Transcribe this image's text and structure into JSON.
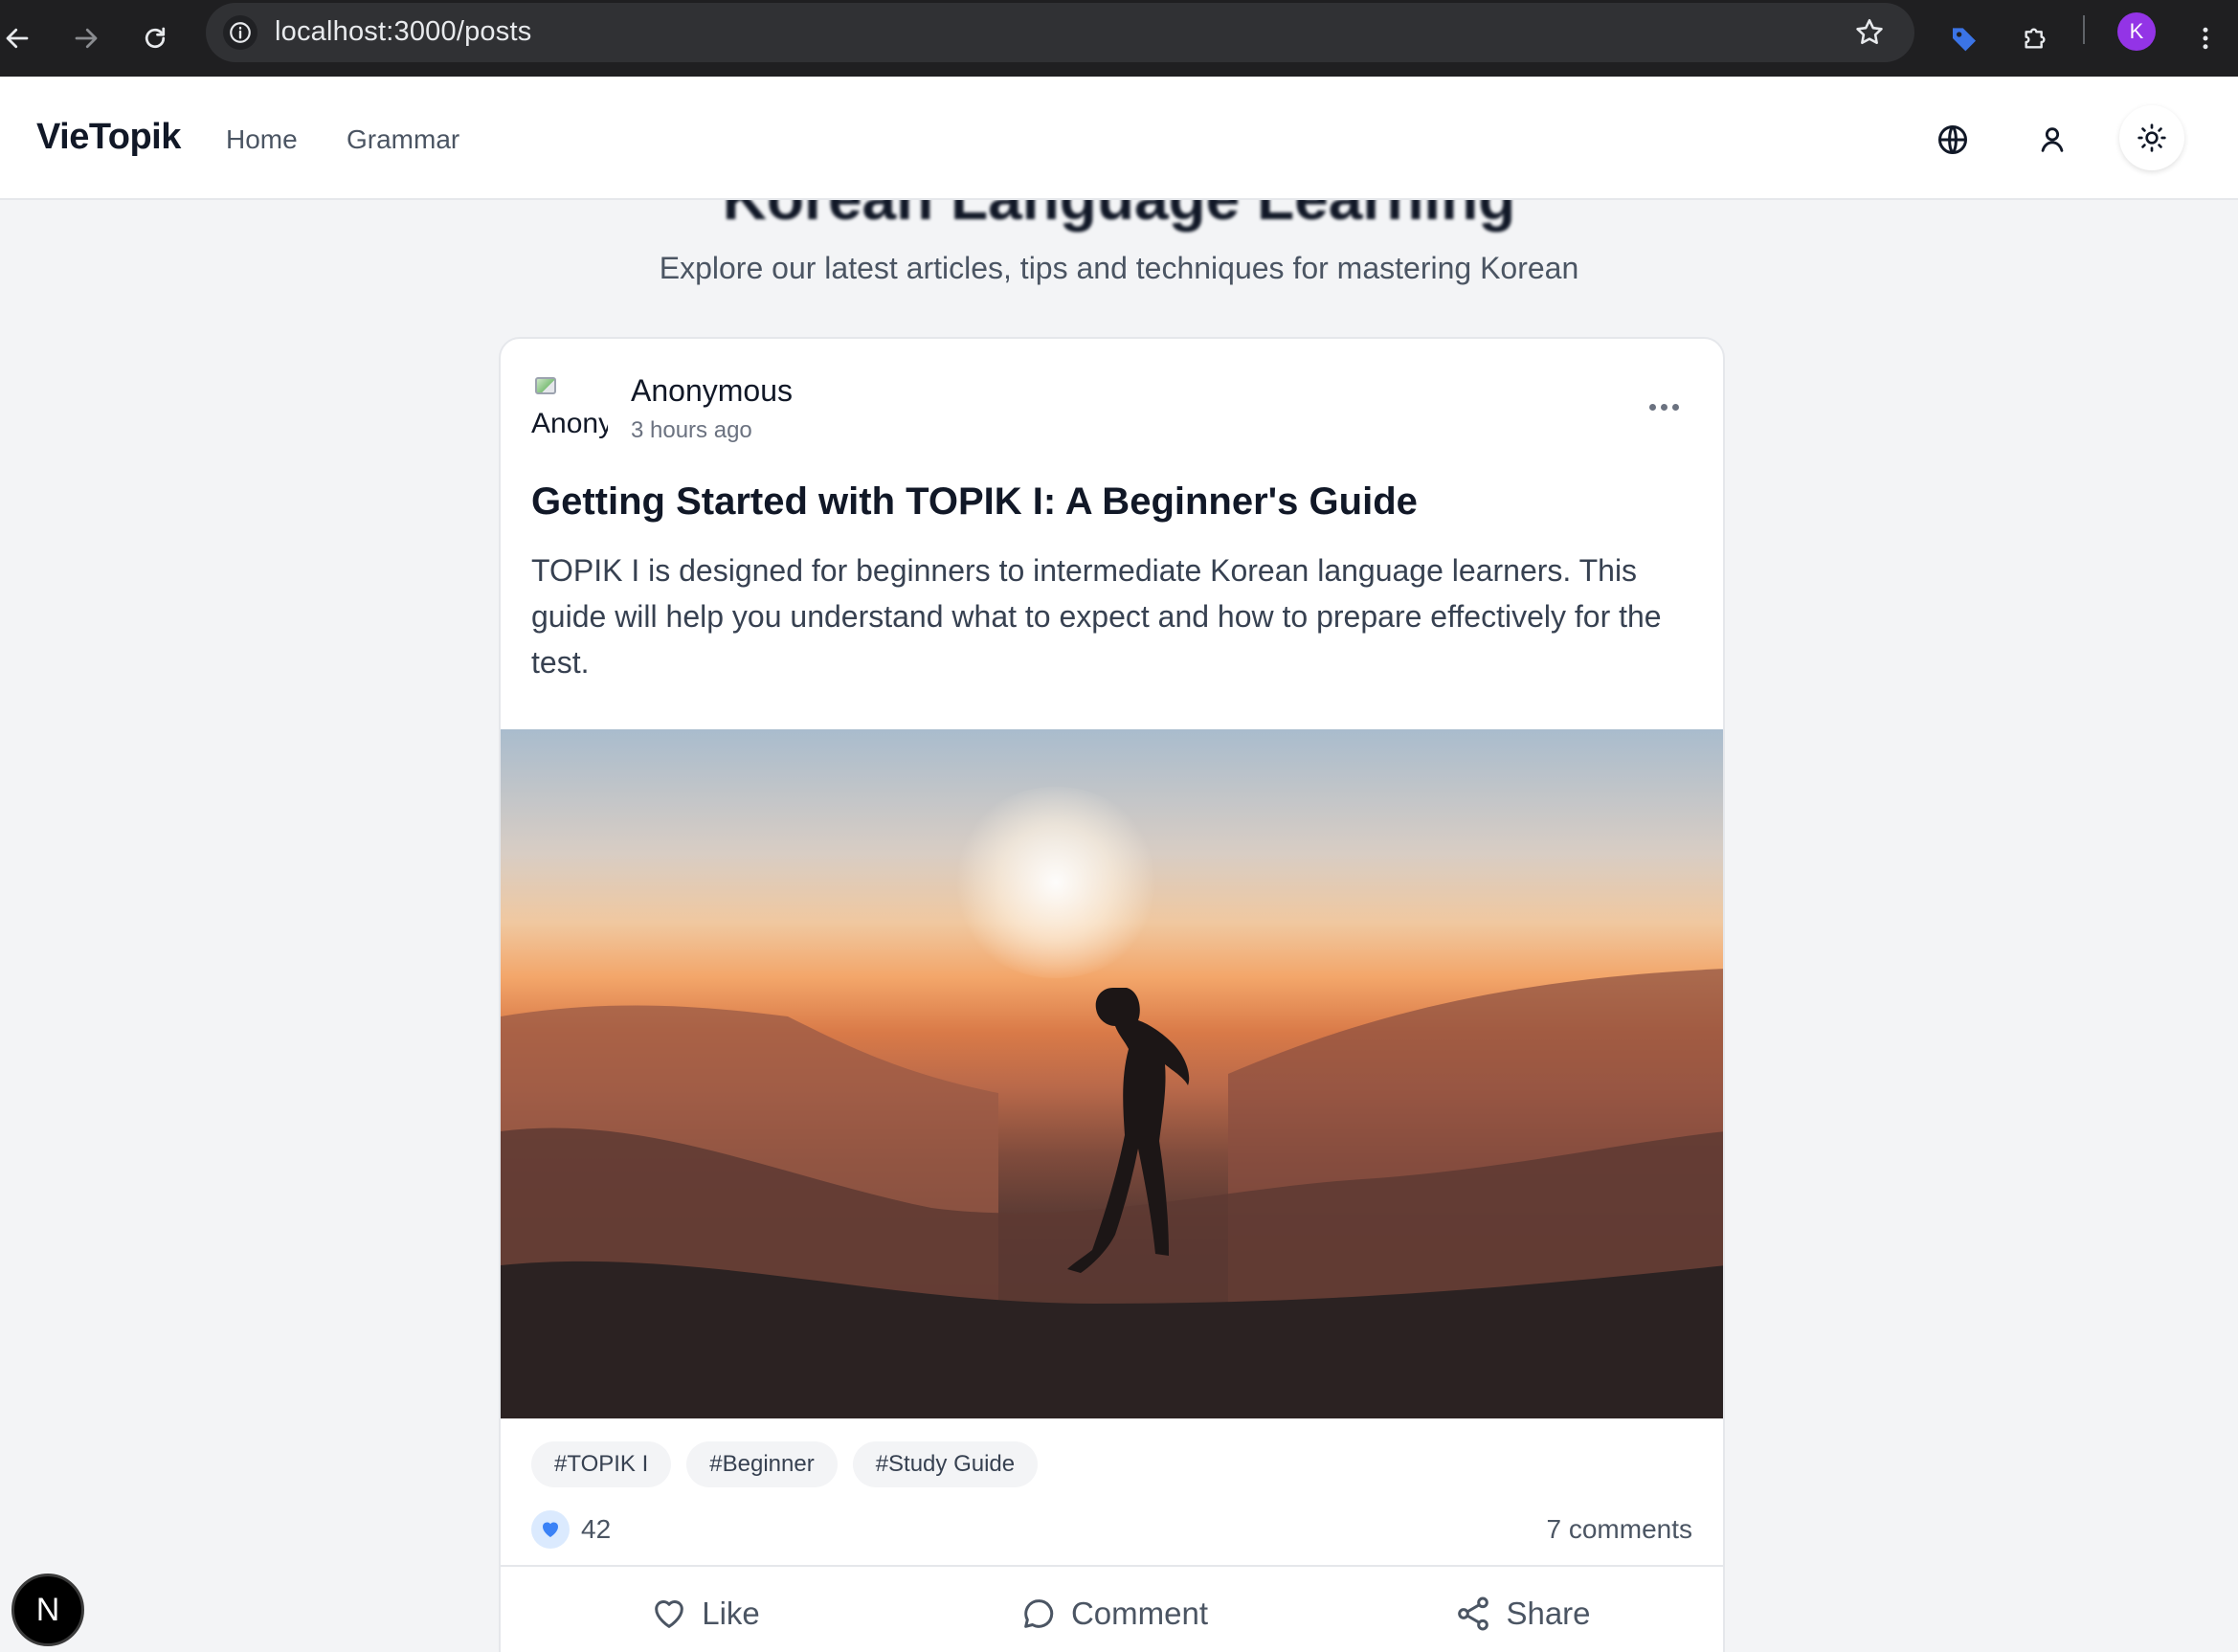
{
  "browser": {
    "url": "localhost:3000/posts",
    "profile_initial": "K",
    "icons": [
      "back-arrow-icon",
      "forward-arrow-icon",
      "reload-icon",
      "site-info-icon",
      "bookmark-star-icon",
      "extension-tag-icon",
      "extensions-puzzle-icon",
      "kebab-menu-icon"
    ]
  },
  "header": {
    "brand": "VieTopik",
    "nav": {
      "home": "Home",
      "grammar": "Grammar"
    },
    "icons": [
      "globe-icon",
      "user-icon",
      "sun-icon"
    ]
  },
  "hero": {
    "title": "Korean Language Learning",
    "subtitle": "Explore our latest articles, tips and techniques for mastering Korean"
  },
  "post": {
    "avatar_alt": "Anonymous",
    "author": "Anonymous",
    "time": "3 hours ago",
    "title": "Getting Started with TOPIK I: A Beginner's Guide",
    "body": "TOPIK I is designed for beginners to intermediate Korean language learners. This guide will help you understand what to expect and how to prepare effectively for the test.",
    "tags": [
      "#TOPIK I",
      "#Beginner",
      "#Study Guide"
    ],
    "likes": "42",
    "comments": "7 comments",
    "actions": {
      "like": "Like",
      "comment": "Comment",
      "share": "Share"
    }
  },
  "dev_badge": {
    "letter": "N"
  },
  "colors": {
    "accent": "#3b82f6",
    "chrome_bg": "#1f1f21",
    "page_bg": "#f3f4f6"
  }
}
